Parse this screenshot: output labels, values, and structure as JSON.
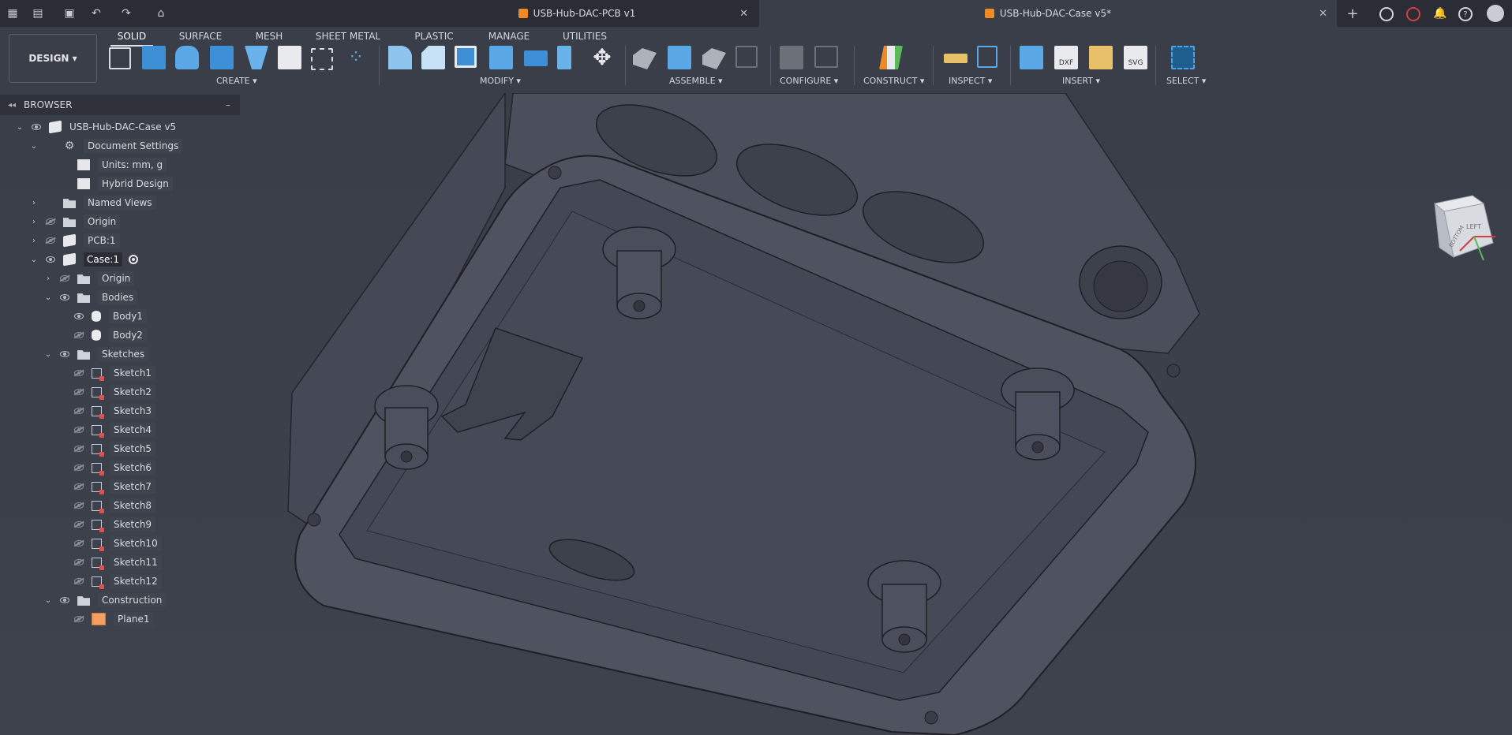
{
  "titlebar": {
    "tabs": [
      {
        "label": "USB-Hub-DAC-PCB v1",
        "active": false
      },
      {
        "label": "USB-Hub-DAC-Case v5*",
        "active": true
      }
    ],
    "close_glyph": "✕",
    "new_tab_glyph": "+",
    "left_icons": [
      "apps-grid-icon",
      "file-icon",
      "save-icon",
      "undo-icon",
      "redo-icon",
      "home-icon"
    ],
    "right_icons": [
      "add-tab-icon",
      "extensions-icon",
      "job-status-icon",
      "notifications-icon",
      "help-icon",
      "avatar-icon"
    ]
  },
  "toolbar": {
    "design_label": "DESIGN ▾",
    "ribbon_tabs": [
      "SOLID",
      "SURFACE",
      "MESH",
      "SHEET METAL",
      "PLASTIC",
      "MANAGE",
      "UTILITIES"
    ],
    "active_tab": "SOLID",
    "groups": [
      "CREATE ▾",
      "MODIFY ▾",
      "ASSEMBLE ▾",
      "CONFIGURE ▾",
      "CONSTRUCT ▾",
      "INSPECT ▾",
      "INSERT ▾",
      "SELECT ▾"
    ],
    "accent": "#1e8fd6"
  },
  "browser": {
    "title": "BROWSER",
    "collapse_glyph": "–",
    "nav_glyph": "◂◂",
    "items": [
      {
        "label": "USB-Hub-DAC-Case v5",
        "level": 0,
        "chev": "⌄",
        "icon": "component-icon",
        "eye": "visible"
      },
      {
        "label": "Document Settings",
        "level": 1,
        "chev": "⌄",
        "icon": "gear-icon",
        "eye": "none"
      },
      {
        "label": "Units: mm, g",
        "level": 2,
        "chev": "",
        "icon": "document-icon",
        "eye": "none"
      },
      {
        "label": "Hybrid Design",
        "level": 2,
        "chev": "",
        "icon": "design-icon",
        "eye": "none"
      },
      {
        "label": "Named Views",
        "level": 1,
        "chev": "›",
        "icon": "folder-icon",
        "eye": "none"
      },
      {
        "label": "Origin",
        "level": 1,
        "chev": "›",
        "icon": "folder-icon",
        "eye": "hidden"
      },
      {
        "label": "PCB:1",
        "level": 1,
        "chev": "›",
        "icon": "component-icon",
        "eye": "hidden"
      },
      {
        "label": "Case:1",
        "level": 1,
        "chev": "⌄",
        "icon": "component-icon",
        "eye": "visible"
      },
      {
        "label": "Origin",
        "level": 2,
        "chev": "›",
        "icon": "folder-icon",
        "eye": "hidden"
      },
      {
        "label": "Bodies",
        "level": 2,
        "chev": "⌄",
        "icon": "folder-icon",
        "eye": "visible"
      },
      {
        "label": "Body1",
        "level": 3,
        "chev": "",
        "icon": "body-icon",
        "eye": "visible"
      },
      {
        "label": "Body2",
        "level": 3,
        "chev": "",
        "icon": "body-icon",
        "eye": "hidden"
      },
      {
        "label": "Sketches",
        "level": 2,
        "chev": "⌄",
        "icon": "folder-icon",
        "eye": "visible"
      },
      {
        "label": "Sketch1",
        "level": 3,
        "chev": "",
        "icon": "sketch-icon",
        "eye": "hidden"
      },
      {
        "label": "Sketch2",
        "level": 3,
        "chev": "",
        "icon": "sketch-icon",
        "eye": "hidden"
      },
      {
        "label": "Sketch3",
        "level": 3,
        "chev": "",
        "icon": "sketch-icon",
        "eye": "hidden"
      },
      {
        "label": "Sketch4",
        "level": 3,
        "chev": "",
        "icon": "sketch-icon",
        "eye": "hidden"
      },
      {
        "label": "Sketch5",
        "level": 3,
        "chev": "",
        "icon": "sketch-icon",
        "eye": "hidden"
      },
      {
        "label": "Sketch6",
        "level": 3,
        "chev": "",
        "icon": "sketch-icon",
        "eye": "hidden"
      },
      {
        "label": "Sketch7",
        "level": 3,
        "chev": "",
        "icon": "sketch-icon",
        "eye": "hidden"
      },
      {
        "label": "Sketch8",
        "level": 3,
        "chev": "",
        "icon": "sketch-icon",
        "eye": "hidden"
      },
      {
        "label": "Sketch9",
        "level": 3,
        "chev": "",
        "icon": "sketch-icon",
        "eye": "hidden"
      },
      {
        "label": "Sketch10",
        "level": 3,
        "chev": "",
        "icon": "sketch-icon",
        "eye": "hidden"
      },
      {
        "label": "Sketch11",
        "level": 3,
        "chev": "",
        "icon": "sketch-icon",
        "eye": "hidden"
      },
      {
        "label": "Sketch12",
        "level": 3,
        "chev": "",
        "icon": "sketch-icon",
        "eye": "hidden"
      },
      {
        "label": "Construction",
        "level": 2,
        "chev": "⌄",
        "icon": "folder-icon",
        "eye": "visible"
      },
      {
        "label": "Plane1",
        "level": 3,
        "chev": "",
        "icon": "plane-icon",
        "eye": "hidden"
      }
    ]
  },
  "viewcube": {
    "faces": [
      "LEFT",
      "BOTTOM"
    ]
  }
}
